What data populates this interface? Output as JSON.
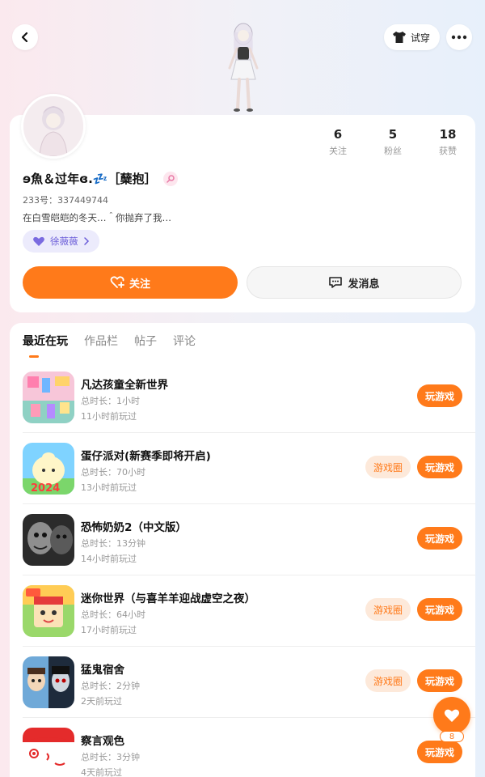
{
  "header": {
    "tryon_label": "试穿"
  },
  "profile": {
    "nickname": "ɘ魚＆过年ɞ.💤［蘖抱］",
    "uid_line": "233号：337449744",
    "bio": "在白雪皑皑的冬天…＾你抛弃了我…",
    "tag_label": "徐薇薇",
    "stats": [
      {
        "value": "6",
        "label": "关注"
      },
      {
        "value": "5",
        "label": "粉丝"
      },
      {
        "value": "18",
        "label": "获赞"
      }
    ],
    "follow_label": "关注",
    "message_label": "发消息"
  },
  "tabs": [
    "最近在玩",
    "作品栏",
    "帖子",
    "评论"
  ],
  "games": [
    {
      "title": "凡达孩童全新世界",
      "duration": "总时长：1小时",
      "last_played": "11小时前玩过",
      "has_circle": false
    },
    {
      "title": "蛋仔派对(新赛季即将开启)",
      "duration": "总时长：70小时",
      "last_played": "13小时前玩过",
      "has_circle": true
    },
    {
      "title": "恐怖奶奶2（中文版）",
      "duration": "总时长：13分钟",
      "last_played": "14小时前玩过",
      "has_circle": false
    },
    {
      "title": "迷你世界（与喜羊羊迎战虚空之夜）",
      "duration": "总时长：64小时",
      "last_played": "17小时前玩过",
      "has_circle": true
    },
    {
      "title": "猛鬼宿舍",
      "duration": "总时长：2分钟",
      "last_played": "2天前玩过",
      "has_circle": true
    },
    {
      "title": "察言观色",
      "duration": "总时长：3分钟",
      "last_played": "4天前玩过",
      "has_circle": false
    }
  ],
  "buttons": {
    "play_label": "玩游戏",
    "circle_label": "游戏圈"
  },
  "fab": {
    "count": "8"
  },
  "colors": {
    "accent": "#ff7a1a",
    "tag_purple": "#6a5cd8"
  }
}
